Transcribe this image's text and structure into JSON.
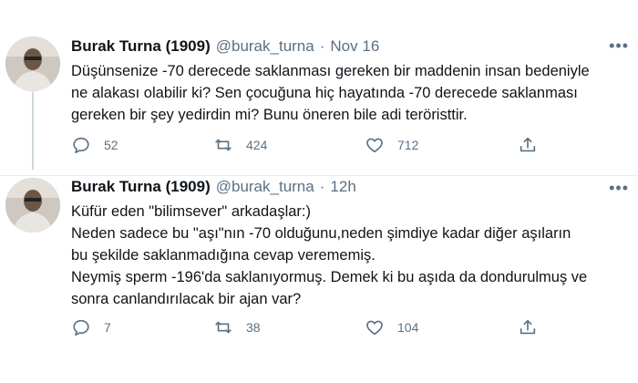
{
  "tweets": [
    {
      "name": "Burak Turna (1909)",
      "handle": "@burak_turna",
      "separator": "·",
      "time": "Nov 16",
      "more": "•••",
      "lines": [
        "Düşünsenize -70 derecede saklanması gereken bir maddenin insan bedeniyle",
        "ne alakası olabilir ki? Sen çocuğuna hiç hayatında -70 derecede saklanması",
        "gereken bir şey yedirdin mi? Bunu öneren bile adi teröristtir."
      ],
      "replies": "52",
      "retweets": "424",
      "likes": "712"
    },
    {
      "name": "Burak Turna (1909)",
      "handle": "@burak_turna",
      "separator": "·",
      "time": "12h",
      "more": "•••",
      "lines": [
        "Küfür eden \"bilimsever\" arkadaşlar:)",
        "Neden sadece bu \"aşı\"nın -70 olduğunu,neden şimdiye kadar diğer aşıların",
        "bu şekilde saklanmadığına cevap verememiş.",
        "Neymiş sperm -196'da saklanıyormuş. Demek ki bu aşıda da dondurulmuş ve",
        "sonra canlandırılacak bir ajan var?"
      ],
      "replies": "7",
      "retweets": "38",
      "likes": "104"
    }
  ],
  "icons": {
    "reply": "reply-icon",
    "retweet": "retweet-icon",
    "like": "heart-icon",
    "share": "share-icon",
    "more": "more-icon"
  },
  "colors": {
    "text": "#0f1419",
    "secondary": "#5b7083",
    "divider": "#e6ecf0"
  }
}
